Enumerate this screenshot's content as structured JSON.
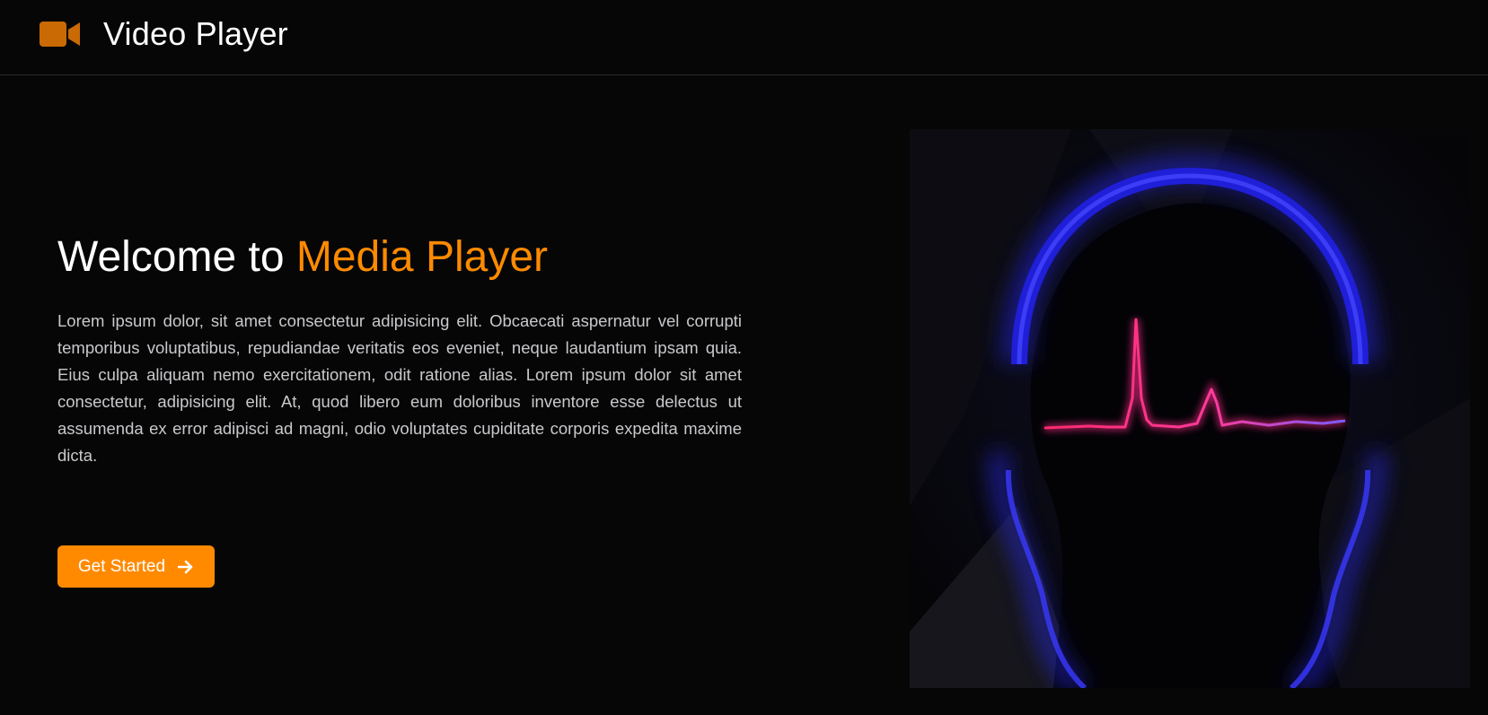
{
  "navbar": {
    "brand_icon": "video-camera-icon",
    "title": "Video Player"
  },
  "hero": {
    "title_prefix": "Welcome to ",
    "title_accent": "Media Player",
    "body": "Lorem ipsum dolor, sit amet consectetur adipisicing elit. Obcaecati aspernatur vel corrupti temporibus voluptatibus, repudiandae veritatis eos eveniet, neque laudantium ipsam quia. Eius culpa aliquam nemo exercitationem, odit ratione alias. Lorem ipsum dolor sit amet consectetur, adipisicing elit. At, quod libero eum doloribus inventore esse delectus ut assumenda ex error adipisci ad magni, odio voluptates cupiditate corporis expedita maxime dicta.",
    "cta_label": "Get Started",
    "cta_icon": "arrow-right-icon",
    "illustration": "headphones-heartbeat-illustration"
  },
  "colors": {
    "accent": "#ff8a00",
    "background": "#060607",
    "text_primary": "#ffffff",
    "text_body": "#c9c9cc",
    "icon_brand": "#c96a05"
  }
}
